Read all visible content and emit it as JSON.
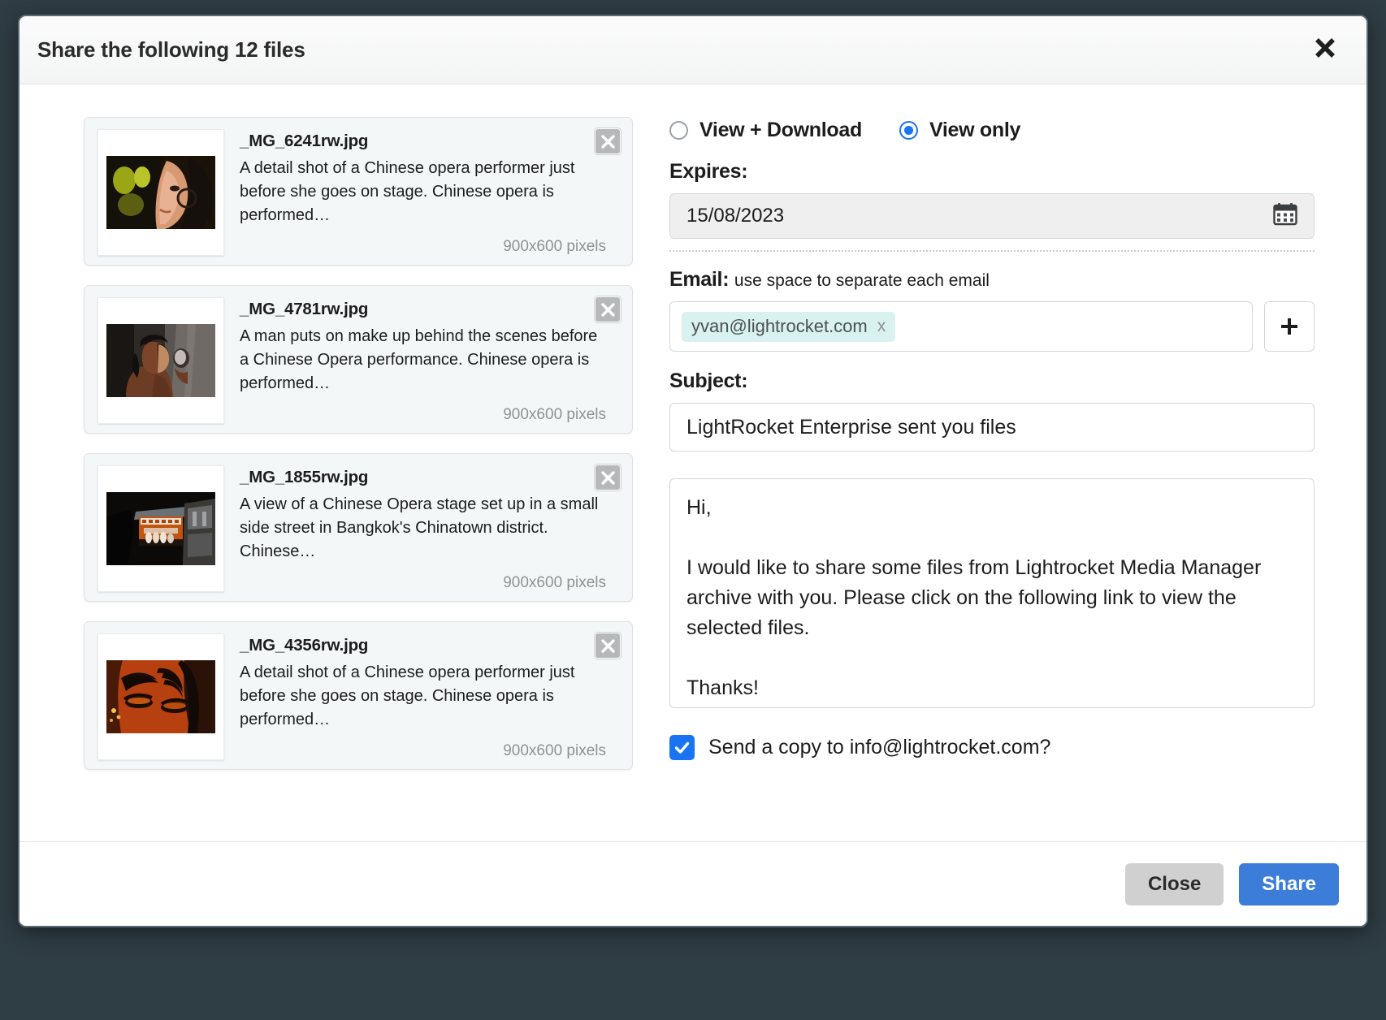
{
  "dialog": {
    "title": "Share the following 12 files",
    "close_icon": "close-x-icon"
  },
  "files": [
    {
      "name": "_MG_6241rw.jpg",
      "description": "A detail shot of a Chinese opera performer just before she goes on stage. Chinese opera is performed…",
      "dimensions": "900x600 pixels",
      "remove_label": "remove"
    },
    {
      "name": "_MG_4781rw.jpg",
      "description": "A man puts on make up behind the scenes before a Chinese Opera performance. Chinese opera is performed…",
      "dimensions": "900x600 pixels",
      "remove_label": "remove"
    },
    {
      "name": "_MG_1855rw.jpg",
      "description": "A view of a Chinese Opera stage set up in a small side street in Bangkok's Chinatown district. Chinese…",
      "dimensions": "900x600 pixels",
      "remove_label": "remove"
    },
    {
      "name": "_MG_4356rw.jpg",
      "description": "A detail shot of a Chinese opera performer just before she goes on stage. Chinese opera is performed…",
      "dimensions": "900x600 pixels",
      "remove_label": "remove"
    }
  ],
  "form": {
    "permission": {
      "options": [
        "View + Download",
        "View only"
      ],
      "selected": "View only"
    },
    "expires": {
      "label": "Expires:",
      "value": "15/08/2023",
      "calendar_icon": "calendar-icon"
    },
    "email": {
      "label": "Email:",
      "hint": "use space to separate each email",
      "chips": [
        "yvan@lightrocket.com"
      ],
      "chip_remove": "x",
      "add_icon": "plus-icon"
    },
    "subject": {
      "label": "Subject:",
      "value": "LightRocket Enterprise sent you files"
    },
    "message": {
      "value": "Hi,\n\nI would like to share some files from Lightrocket Media Manager archive with you. Please click on the following link to view the selected files.\n\nThanks!"
    },
    "send_copy": {
      "label": "Send a copy to info@lightrocket.com?",
      "checked": true
    }
  },
  "footer": {
    "close_label": "Close",
    "share_label": "Share"
  },
  "colors": {
    "accent_blue": "#1874f0",
    "share_button": "#3b7dd8",
    "close_button": "#d0d0d0",
    "chip_background": "#d9f1ef",
    "card_background": "#f4f7f8"
  }
}
